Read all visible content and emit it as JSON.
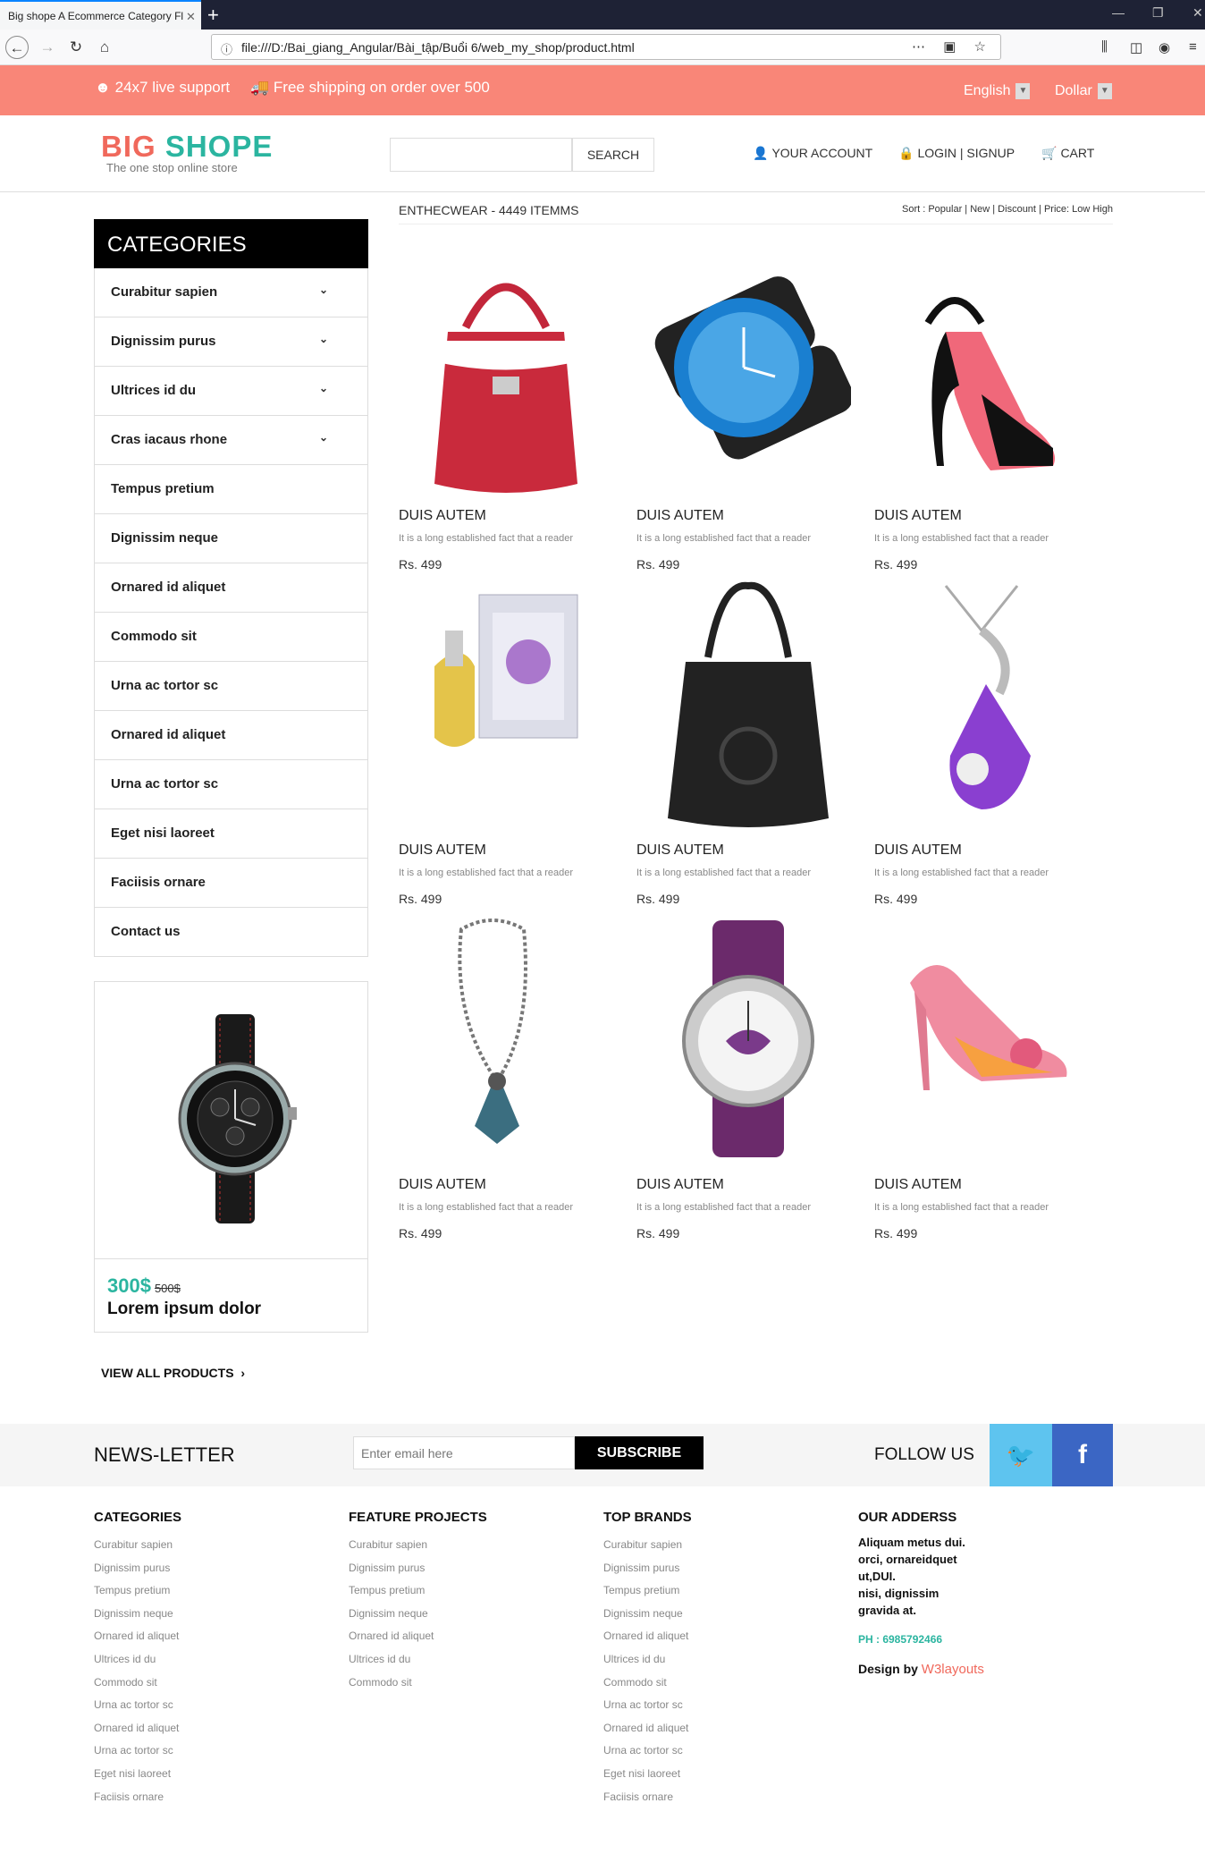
{
  "browser": {
    "tab_title": "Big shope A Ecommerce Category Fl",
    "url": "file:///D:/Bai_giang_Angular/Bài_tập/Buổi 6/web_my_shop/product.html"
  },
  "topbar": {
    "support": "24x7 live support",
    "shipping": "Free shipping on order over 500",
    "language": "English",
    "currency": "Dollar"
  },
  "header": {
    "logo_part1": "BIG",
    "logo_part2": "SHOPE",
    "tagline": "The one stop online store",
    "search_button": "SEARCH",
    "account": "YOUR ACCOUNT",
    "login": "LOGIN | SIGNUP",
    "cart": "CART"
  },
  "sidebar": {
    "title": "CATEGORIES",
    "items": [
      {
        "label": "Curabitur sapien",
        "chevron": true
      },
      {
        "label": "Dignissim purus",
        "chevron": true
      },
      {
        "label": "Ultrices id du",
        "chevron": true
      },
      {
        "label": "Cras iacaus rhone",
        "chevron": true
      },
      {
        "label": "Tempus pretium",
        "chevron": false
      },
      {
        "label": "Dignissim neque",
        "chevron": false
      },
      {
        "label": "Ornared id aliquet",
        "chevron": false
      },
      {
        "label": "Commodo sit",
        "chevron": false
      },
      {
        "label": "Urna ac tortor sc",
        "chevron": false
      },
      {
        "label": "Ornared id aliquet",
        "chevron": false
      },
      {
        "label": "Urna ac tortor sc",
        "chevron": false
      },
      {
        "label": "Eget nisi laoreet",
        "chevron": false
      },
      {
        "label": "Faciisis ornare",
        "chevron": false
      },
      {
        "label": "Contact us",
        "chevron": false
      }
    ],
    "promo": {
      "price": "300$",
      "old_price": "500$",
      "name": "Lorem ipsum dolor"
    },
    "view_all": "VIEW ALL PRODUCTS"
  },
  "listing": {
    "title": "ENTHECWEAR - 4449 ITEMMS",
    "sort": "Sort : Popular | New | Discount | Price: Low High"
  },
  "products": [
    {
      "icon": "red-handbag-icon",
      "name": "DUIS AUTEM",
      "desc": "It is a long established fact that a reader",
      "price": "Rs. 499"
    },
    {
      "icon": "blue-watch-icon",
      "name": "DUIS AUTEM",
      "desc": "It is a long established fact that a reader",
      "price": "Rs. 499"
    },
    {
      "icon": "pink-sandal-icon",
      "name": "DUIS AUTEM",
      "desc": "It is a long established fact that a reader",
      "price": "Rs. 499"
    },
    {
      "icon": "perfume-icon",
      "name": "DUIS AUTEM",
      "desc": "It is a long established fact that a reader",
      "price": "Rs. 499"
    },
    {
      "icon": "black-handbag-icon",
      "name": "DUIS AUTEM",
      "desc": "It is a long established fact that a reader",
      "price": "Rs. 499"
    },
    {
      "icon": "purple-pendant-icon",
      "name": "DUIS AUTEM",
      "desc": "It is a long established fact that a reader",
      "price": "Rs. 499"
    },
    {
      "icon": "necklace-icon",
      "name": "DUIS AUTEM",
      "desc": "It is a long established fact that a reader",
      "price": "Rs. 499"
    },
    {
      "icon": "purple-watch-icon",
      "name": "DUIS AUTEM",
      "desc": "It is a long established fact that a reader",
      "price": "Rs. 499"
    },
    {
      "icon": "pink-heel-icon",
      "name": "DUIS AUTEM",
      "desc": "It is a long established fact that a reader",
      "price": "Rs. 499"
    }
  ],
  "newsletter": {
    "title": "NEWS-LETTER",
    "placeholder": "Enter email here",
    "button": "SUBSCRIBE",
    "follow": "FOLLOW US"
  },
  "footer": {
    "categories": {
      "title": "CATEGORIES",
      "links": [
        "Curabitur sapien",
        "Dignissim purus",
        "Tempus pretium",
        "Dignissim neque",
        "Ornared id aliquet",
        "Ultrices id du",
        "Commodo sit",
        "Urna ac tortor sc",
        "Ornared id aliquet",
        "Urna ac tortor sc",
        "Eget nisi laoreet",
        "Faciisis ornare"
      ]
    },
    "feature": {
      "title": "FEATURE PROJECTS",
      "links": [
        "Curabitur sapien",
        "Dignissim purus",
        "Tempus pretium",
        "Dignissim neque",
        "Ornared id aliquet",
        "Ultrices id du",
        "Commodo sit"
      ]
    },
    "brands": {
      "title": "TOP BRANDS",
      "links": [
        "Curabitur sapien",
        "Dignissim purus",
        "Tempus pretium",
        "Dignissim neque",
        "Ornared id aliquet",
        "Ultrices id du",
        "Commodo sit",
        "Urna ac tortor sc",
        "Ornared id aliquet",
        "Urna ac tortor sc",
        "Eget nisi laoreet",
        "Faciisis ornare"
      ]
    },
    "address": {
      "title": "OUR ADDERSS",
      "lines": [
        "Aliquam metus dui.",
        "orci, ornareidquet",
        "ut,DUI.",
        "nisi, dignissim",
        "gravida at."
      ],
      "phone": "PH : 6985792466",
      "design_by": "Design by",
      "design_brand": "W3layouts"
    }
  }
}
